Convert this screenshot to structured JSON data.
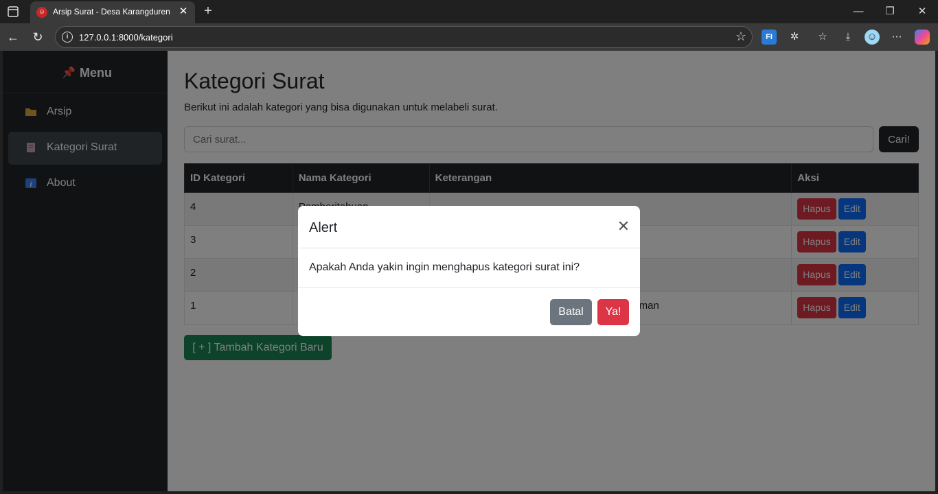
{
  "browser": {
    "tab_title": "Arsip Surat - Desa Karangduren",
    "url": "127.0.0.1:8000/kategori"
  },
  "sidebar": {
    "header": "Menu",
    "items": [
      {
        "label": "Arsip",
        "icon": "folder-icon"
      },
      {
        "label": "Kategori Surat",
        "icon": "notebook-icon",
        "active": true
      },
      {
        "label": "About",
        "icon": "info-icon"
      }
    ]
  },
  "main": {
    "title": "Kategori Surat",
    "subtitle": "Berikut ini adalah kategori yang bisa digunakan untuk melabeli surat.",
    "search_placeholder": "Cari surat...",
    "search_button": "Cari!",
    "table": {
      "headers": [
        "ID Kategori",
        "Nama Kategori",
        "Keterangan",
        "Aksi"
      ],
      "rows": [
        {
          "id": "4",
          "nama": "Pemberitahuan",
          "keterangan": ""
        },
        {
          "id": "3",
          "nama": "",
          "keterangan": ""
        },
        {
          "id": "2",
          "nama": "",
          "keterangan": ""
        },
        {
          "id": "1",
          "nama": "",
          "keterangan": "man"
        }
      ],
      "hapus_label": "Hapus",
      "edit_label": "Edit"
    },
    "add_button": "[ + ] Tambah Kategori Baru"
  },
  "modal": {
    "title": "Alert",
    "message": "Apakah Anda yakin ingin menghapus kategori surat ini?",
    "cancel_label": "Batal",
    "confirm_label": "Ya!"
  }
}
